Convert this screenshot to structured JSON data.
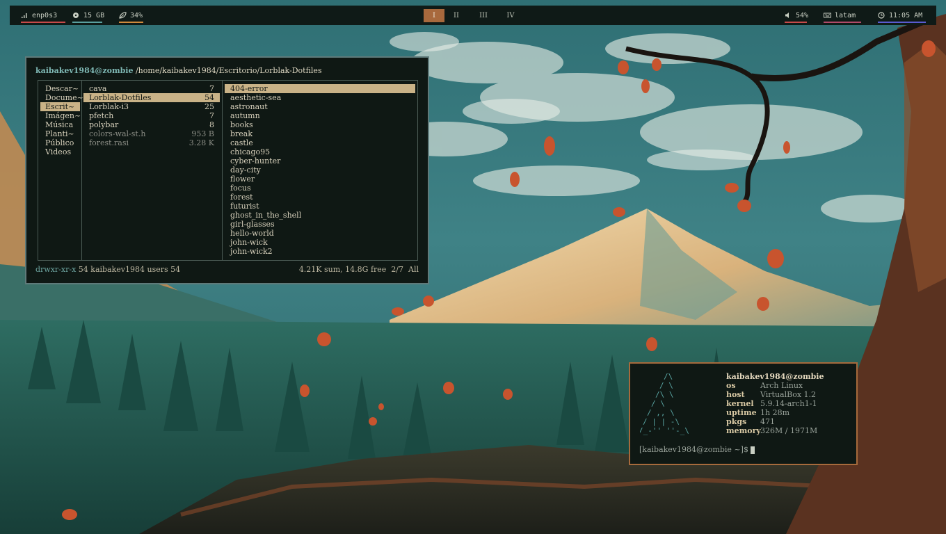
{
  "topbar": {
    "network": "enp0s3",
    "disk": "15 GB",
    "cpu": "34%",
    "workspaces": [
      "I",
      "II",
      "III",
      "IV"
    ],
    "active_workspace": "I",
    "volume": "54%",
    "keyboard": "latam",
    "clock": "11:05 AM",
    "colors": {
      "network": "#c74a4a",
      "disk": "#5aa0a0",
      "cpu": "#d08a3c",
      "volume": "#c74a4a",
      "keyboard": "#b04a6a",
      "clock": "#5a5ad0",
      "active_ws": "#a8693d"
    }
  },
  "ranger": {
    "user_host": "kaibakev1984@zombie",
    "path": "/home/kaibakev1984/Escritorio/Lorblak-Dotfiles",
    "parent_column": [
      "Descar~",
      "Docume~",
      "Escrit~",
      "Imágen~",
      "Música",
      "Planti~",
      "Público",
      "Videos"
    ],
    "parent_selected": "Escrit~",
    "current_column": [
      {
        "name": "cava",
        "count": "7"
      },
      {
        "name": "Lorblak-Dotfiles",
        "count": "54"
      },
      {
        "name": "Lorblak-i3",
        "count": "25"
      },
      {
        "name": "pfetch",
        "count": "7"
      },
      {
        "name": "polybar",
        "count": "8"
      },
      {
        "name": "colors-wal-st.h",
        "count": "953 B"
      },
      {
        "name": "forest.rasi",
        "count": "3.28 K"
      }
    ],
    "current_selected": "Lorblak-Dotfiles",
    "preview_column": [
      "404-error",
      "aesthetic-sea",
      "astronaut",
      "autumn",
      "books",
      "break",
      "castle",
      "chicago95",
      "cyber-hunter",
      "day-city",
      "flower",
      "focus",
      "forest",
      "futurist",
      "ghost_in_the_shell",
      "girl-glasses",
      "hello-world",
      "john-wick",
      "john-wick2"
    ],
    "preview_selected": "404-error",
    "status": {
      "permissions": "drwxr-xr-x",
      "info": "54 kaibakev1984 users 54",
      "summary": "4.21K sum, 14.8G free",
      "position": "2/7",
      "view": "All"
    }
  },
  "fetch": {
    "user_host": "kaibakev1984@zombie",
    "fields": [
      {
        "key": "os",
        "value": "Arch Linux"
      },
      {
        "key": "host",
        "value": "VirtualBox 1.2"
      },
      {
        "key": "kernel",
        "value": "5.9.14-arch1-1"
      },
      {
        "key": "uptime",
        "value": "1h 28m"
      },
      {
        "key": "pkgs",
        "value": "471"
      },
      {
        "key": "memory",
        "value": "326M / 1971M"
      }
    ],
    "prompt": "[kaibakev1984@zombie ~]$"
  }
}
